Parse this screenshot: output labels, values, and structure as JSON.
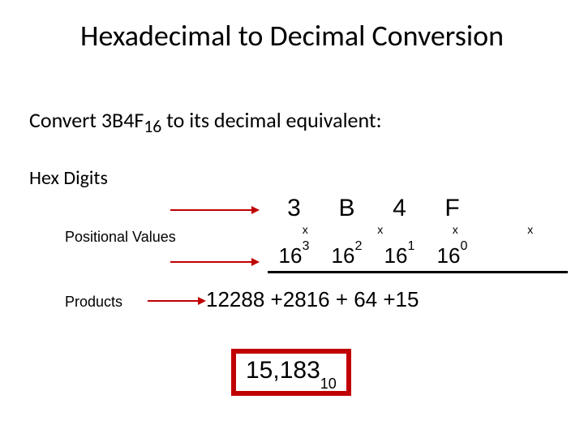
{
  "title": "Hexadecimal to Decimal Conversion",
  "subtitle_prefix": "Convert 3B4F",
  "subtitle_subscript": "16",
  "subtitle_suffix": " to its decimal equivalent:",
  "labels": {
    "hex_digits": "Hex Digits",
    "positional_values": "Positional Values",
    "products": "Products"
  },
  "hex_digits": [
    "3",
    "B",
    "4",
    "F"
  ],
  "multiplier_symbol": "x",
  "positional": {
    "base": "16",
    "exponents": [
      "3",
      "2",
      "1",
      "0"
    ]
  },
  "products": {
    "parts": [
      "12288",
      "+2816",
      "+ 64",
      "+15"
    ]
  },
  "answer": {
    "value": "15,183",
    "subscript": "10"
  }
}
